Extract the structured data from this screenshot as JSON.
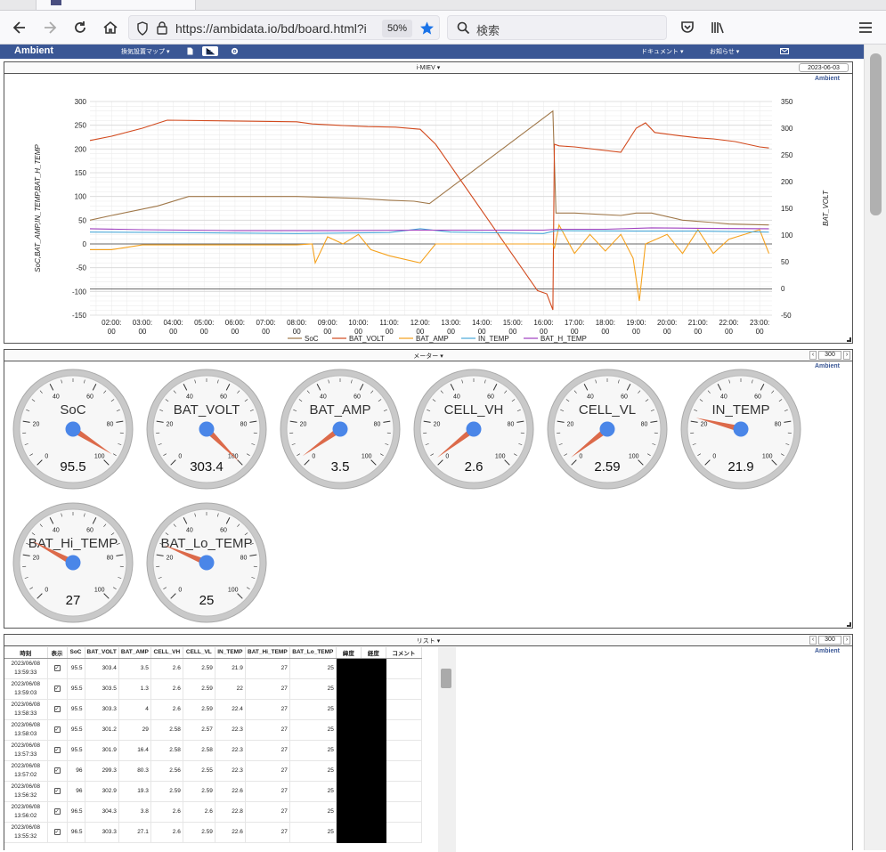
{
  "browser": {
    "url": "https://ambidata.io/bd/board.html?i",
    "zoom": "50%",
    "search_placeholder": "検索"
  },
  "navbar": {
    "brand": "Ambient",
    "map_menu": "換気設置マップ ▾",
    "docs_menu": "ドキュメント ▾",
    "notice_menu": "お知らせ ▾"
  },
  "chart_panel": {
    "title": "i-MIEV ▾",
    "date": "2023-06-03",
    "ambient": "Ambient"
  },
  "meter_panel": {
    "title": "メーター ▾",
    "page_size": "300",
    "ambient": "Ambient"
  },
  "list_panel": {
    "title": "リスト ▾",
    "page_size": "300",
    "ambient": "Ambient",
    "headers": [
      "時刻",
      "表示",
      "SoC",
      "BAT_VOLT",
      "BAT_AMP",
      "CELL_VH",
      "CELL_VL",
      "IN_TEMP",
      "BAT_Hi_TEMP",
      "BAT_Lo_TEMP",
      "緯度",
      "経度",
      "コメント"
    ],
    "rows": [
      {
        "d": "2023/06/08",
        "t": "13:59:33",
        "soc": "95.5",
        "volt": "303.4",
        "amp": "3.5",
        "vh": "2.6",
        "vl": "2.59",
        "in": "21.9",
        "hi": "27",
        "lo": "25"
      },
      {
        "d": "2023/06/08",
        "t": "13:59:03",
        "soc": "95.5",
        "volt": "303.5",
        "amp": "1.3",
        "vh": "2.6",
        "vl": "2.59",
        "in": "22",
        "hi": "27",
        "lo": "25"
      },
      {
        "d": "2023/06/08",
        "t": "13:58:33",
        "soc": "95.5",
        "volt": "303.3",
        "amp": "4",
        "vh": "2.6",
        "vl": "2.59",
        "in": "22.4",
        "hi": "27",
        "lo": "25"
      },
      {
        "d": "2023/06/08",
        "t": "13:58:03",
        "soc": "95.5",
        "volt": "301.2",
        "amp": "29",
        "vh": "2.58",
        "vl": "2.57",
        "in": "22.3",
        "hi": "27",
        "lo": "25"
      },
      {
        "d": "2023/06/08",
        "t": "13:57:33",
        "soc": "95.5",
        "volt": "301.9",
        "amp": "16.4",
        "vh": "2.58",
        "vl": "2.58",
        "in": "22.3",
        "hi": "27",
        "lo": "25"
      },
      {
        "d": "2023/06/08",
        "t": "13:57:02",
        "soc": "96",
        "volt": "299.3",
        "amp": "80.3",
        "vh": "2.56",
        "vl": "2.55",
        "in": "22.3",
        "hi": "27",
        "lo": "25"
      },
      {
        "d": "2023/06/08",
        "t": "13:56:32",
        "soc": "96",
        "volt": "302.9",
        "amp": "19.3",
        "vh": "2.59",
        "vl": "2.59",
        "in": "22.6",
        "hi": "27",
        "lo": "25"
      },
      {
        "d": "2023/06/08",
        "t": "13:56:02",
        "soc": "96.5",
        "volt": "304.3",
        "amp": "3.8",
        "vh": "2.6",
        "vl": "2.6",
        "in": "22.8",
        "hi": "27",
        "lo": "25"
      },
      {
        "d": "2023/06/08",
        "t": "13:55:32",
        "soc": "96.5",
        "volt": "303.3",
        "amp": "27.1",
        "vh": "2.6",
        "vl": "2.59",
        "in": "22.6",
        "hi": "27",
        "lo": "25"
      }
    ]
  },
  "gauges": [
    {
      "label": "SoC",
      "value": "95.5",
      "v": 95.5
    },
    {
      "label": "BAT_VOLT",
      "value": "303.4",
      "v": 303.4
    },
    {
      "label": "BAT_AMP",
      "value": "3.5",
      "v": 3.5
    },
    {
      "label": "CELL_VH",
      "value": "2.6",
      "v": 2.6
    },
    {
      "label": "CELL_VL",
      "value": "2.59",
      "v": 2.59
    },
    {
      "label": "IN_TEMP",
      "value": "21.9",
      "v": 21.9
    },
    {
      "label": "BAT_Hi_TEMP",
      "value": "27",
      "v": 27
    },
    {
      "label": "BAT_Lo_TEMP",
      "value": "25",
      "v": 25
    }
  ],
  "gauge_scale": {
    "min": 0,
    "max": 100,
    "ticks": [
      "0",
      "20",
      "40",
      "60",
      "80",
      "100"
    ]
  },
  "colors": {
    "navbar": "#3a5795",
    "needle": "#dc6a4a",
    "hub": "#4a86e8",
    "soc": "#a0784a",
    "bat_volt": "#d24a1e",
    "bat_amp": "#f5a11c",
    "in_temp": "#4aa8d8",
    "bat_h_temp": "#a040c0"
  },
  "chart_data": {
    "type": "line",
    "ylabel": "SoC,BAT_AMP,IN_TEMP,BAT_H_TEMP",
    "y2label": "BAT_VOLT",
    "ylim": [
      -150,
      300
    ],
    "y2lim": [
      -50,
      350
    ],
    "yticks": [
      "300",
      "250",
      "200",
      "150",
      "100",
      "50",
      "0",
      "-50",
      "-100",
      "-150"
    ],
    "y2ticks": [
      "350",
      "300",
      "250",
      "200",
      "150",
      "100",
      "50",
      "0",
      "-50"
    ],
    "xticks": [
      "02:00:\n00",
      "03:00:\n00",
      "04:00:\n00",
      "05:00:\n00",
      "06:00:\n00",
      "07:00:\n00",
      "08:00:\n00",
      "09:00:\n00",
      "10:00:\n00",
      "11:00:\n00",
      "12:00:\n00",
      "13:00:\n00",
      "14:00:\n00",
      "15:00:\n00",
      "16:00:\n00",
      "17:00:\n00",
      "18:00:\n00",
      "19:00:\n00",
      "20:00:\n00",
      "21:00:\n00",
      "22:00:\n00",
      "23:00:\n00"
    ],
    "grid": true,
    "legend": "bottom",
    "series": [
      {
        "name": "SoC",
        "axis": "left",
        "x": [
          1.3,
          2,
          3.5,
          4.5,
          8,
          10,
          11,
          11.8,
          12.3,
          16.3,
          16.4,
          17,
          18.5,
          19,
          19.5,
          20.5,
          21.5,
          22,
          23.3
        ],
        "y": [
          50,
          60,
          80,
          100,
          100,
          96,
          92,
          90,
          85,
          280,
          65,
          65,
          60,
          65,
          65,
          50,
          45,
          42,
          40
        ]
      },
      {
        "name": "BAT_VOLT",
        "axis": "right",
        "x": [
          1.3,
          2,
          3,
          3.8,
          8,
          8.5,
          9.5,
          10.3,
          11.2,
          12,
          12.5,
          15.8,
          16.1,
          16.3,
          16.35,
          16.5,
          17,
          18.5,
          19,
          19.3,
          19.6,
          20.4,
          21,
          21.5,
          22.2,
          23,
          23.3
        ],
        "y": [
          277,
          285,
          300,
          315,
          312,
          308,
          305,
          303,
          302,
          298,
          270,
          -4,
          -10,
          -40,
          270,
          267,
          265,
          255,
          300,
          310,
          292,
          286,
          282,
          280,
          275,
          265,
          263
        ]
      },
      {
        "name": "BAT_AMP",
        "axis": "left",
        "x": [
          1.3,
          2,
          3,
          3.9,
          6,
          8,
          8.5,
          8.6,
          9,
          9.5,
          10,
          10.4,
          11,
          12,
          12.5,
          13,
          15.5,
          16.3,
          16.35,
          16.5,
          17,
          17.5,
          18,
          18.5,
          18.9,
          19.1,
          19.3,
          20,
          20.5,
          21,
          21.5,
          22,
          23,
          23.3
        ],
        "y": [
          -12,
          -12,
          -2,
          -2,
          -2,
          -2,
          0,
          -40,
          15,
          0,
          20,
          -12,
          -25,
          -40,
          0,
          0,
          0,
          0,
          -10,
          40,
          -20,
          20,
          -15,
          20,
          -30,
          -120,
          0,
          20,
          -20,
          30,
          -20,
          10,
          30,
          -20
        ]
      },
      {
        "name": "IN_TEMP",
        "axis": "left",
        "x": [
          1.3,
          4,
          8,
          11,
          12,
          13,
          16,
          16.4,
          19,
          21,
          23.3
        ],
        "y": [
          25,
          24,
          22,
          24,
          32,
          25,
          22,
          28,
          27,
          27,
          25
        ]
      },
      {
        "name": "BAT_H_TEMP",
        "axis": "left",
        "x": [
          1.3,
          3,
          6,
          9,
          12,
          13,
          16,
          16.4,
          18,
          19.5,
          21,
          23.3
        ],
        "y": [
          32,
          30,
          28,
          28,
          29,
          29,
          29,
          31,
          31,
          34,
          33,
          32
        ]
      }
    ],
    "reference_lines": [
      {
        "axis": "left",
        "y": -95
      },
      {
        "axis": "left",
        "y": 0
      }
    ]
  }
}
